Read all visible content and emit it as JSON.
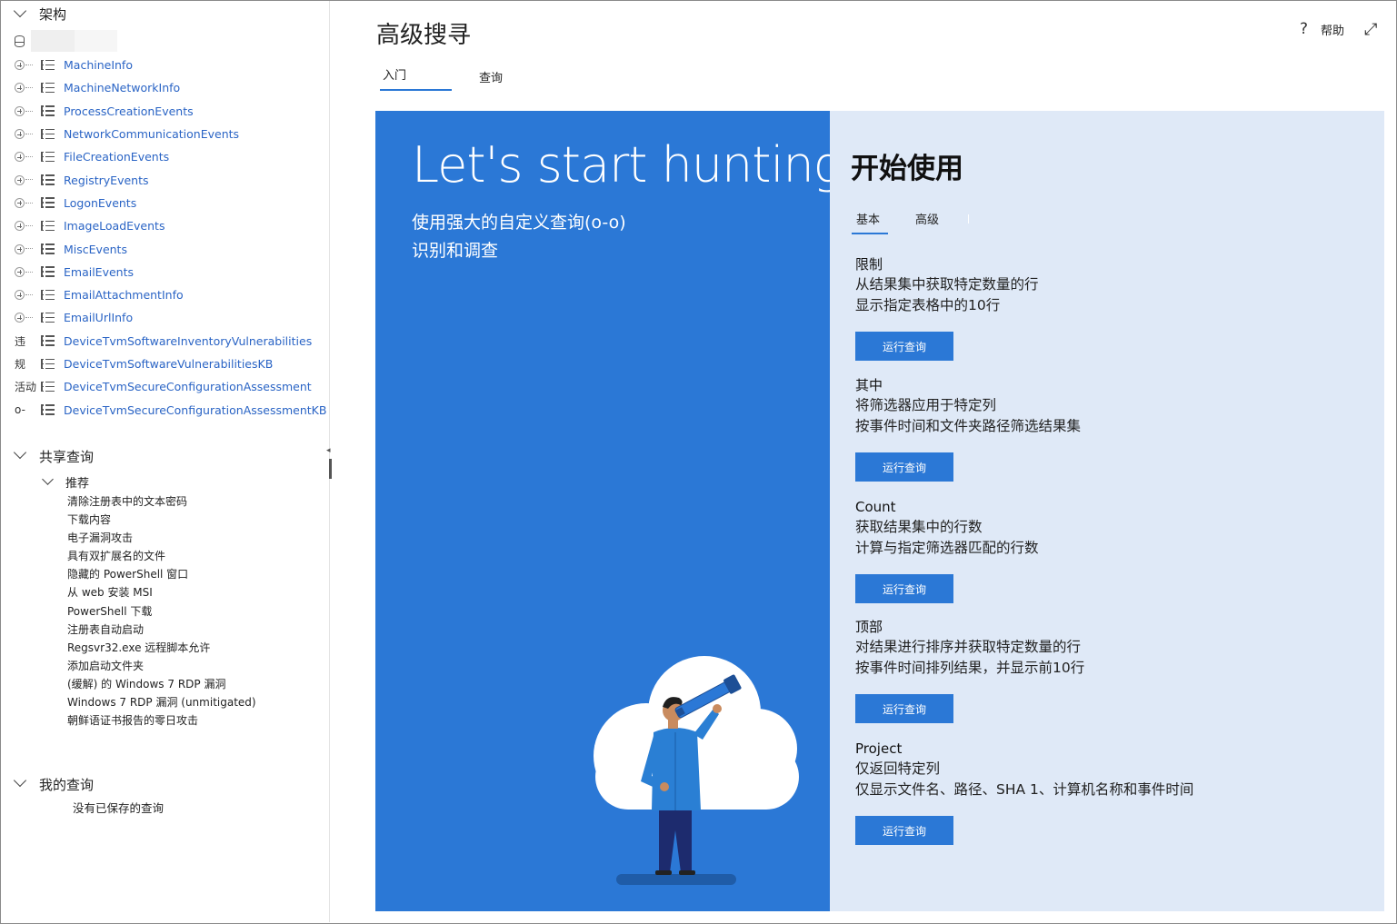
{
  "sidebar": {
    "schema_title": "架构",
    "tables": [
      {
        "label": "MachineInfo",
        "side": ""
      },
      {
        "label": "MachineNetworkInfo",
        "side": ""
      },
      {
        "label": "ProcessCreationEvents",
        "side": ""
      },
      {
        "label": "NetworkCommunicationEvents",
        "side": ""
      },
      {
        "label": "FileCreationEvents",
        "side": ""
      },
      {
        "label": "RegistryEvents",
        "side": ""
      },
      {
        "label": "LogonEvents",
        "side": ""
      },
      {
        "label": "ImageLoadEvents",
        "side": ""
      },
      {
        "label": "MiscEvents",
        "side": ""
      },
      {
        "label": "EmailEvents",
        "side": ""
      },
      {
        "label": "EmailAttachmentInfo",
        "side": ""
      },
      {
        "label": "EmailUrlInfo",
        "side": ""
      },
      {
        "label": "DeviceTvmSoftwareInventoryVulnerabilities",
        "side": "违"
      },
      {
        "label": "DeviceTvmSoftwareVulnerabilitiesKB",
        "side": "规"
      },
      {
        "label": "DeviceTvmSecureConfigurationAssessment",
        "side": "活动"
      },
      {
        "label": "DeviceTvmSecureConfigurationAssessmentKB",
        "side": "o-"
      }
    ],
    "shared_title": "共享查询",
    "recommended_title": "推荐",
    "recommended": [
      "清除注册表中的文本密码",
      "下载内容",
      "电子漏洞攻击",
      "具有双扩展名的文件",
      "隐藏的 PowerShell 窗口",
      "从 web 安装 MSI",
      "PowerShell 下载",
      "注册表自动启动",
      "Regsvr32.exe 远程脚本允许",
      "添加启动文件夹",
      " (缓解) 的 Windows 7 RDP 漏洞",
      "Windows 7 RDP 漏洞 (unmitigated)",
      "朝鲜语证书报告的零日攻击"
    ],
    "my_title": "我的查询",
    "my_empty": "没有已保存的查询"
  },
  "header": {
    "title": "高级搜寻",
    "help_label": "帮助",
    "tabs": [
      "入门",
      "查询"
    ]
  },
  "hero": {
    "title": "Let's start hunting",
    "subtitle": "使用强大的自定义查询(o-o) 识别和调查"
  },
  "panel": {
    "title": "开始使用",
    "tabs": [
      "基本",
      "高级"
    ],
    "examples": [
      {
        "title": "限制",
        "line1": "从结果集中获取特定数量的行",
        "line2": "显示指定表格中的10行",
        "button": "运行查询"
      },
      {
        "title": "其中",
        "line1": "将筛选器应用于特定列",
        "line2": "按事件时间和文件夹路径筛选结果集",
        "button": "运行查询"
      },
      {
        "title": "Count",
        "line1": "获取结果集中的行数",
        "line2": "计算与指定筛选器匹配的行数",
        "button": "运行查询"
      },
      {
        "title": "顶部",
        "line1": "对结果进行排序并获取特定数量的行",
        "line2": "按事件时间排列结果，并显示前10行",
        "button": "运行查询"
      },
      {
        "title": "Project",
        "line1": "仅返回特定列",
        "line2": "仅显示文件名、路径、SHA 1、计算机名称和事件时间",
        "button": "运行查询"
      }
    ]
  },
  "colors": {
    "accent": "#2b78d6",
    "panel_bg": "#dfe9f7",
    "link": "#2a64c5"
  }
}
